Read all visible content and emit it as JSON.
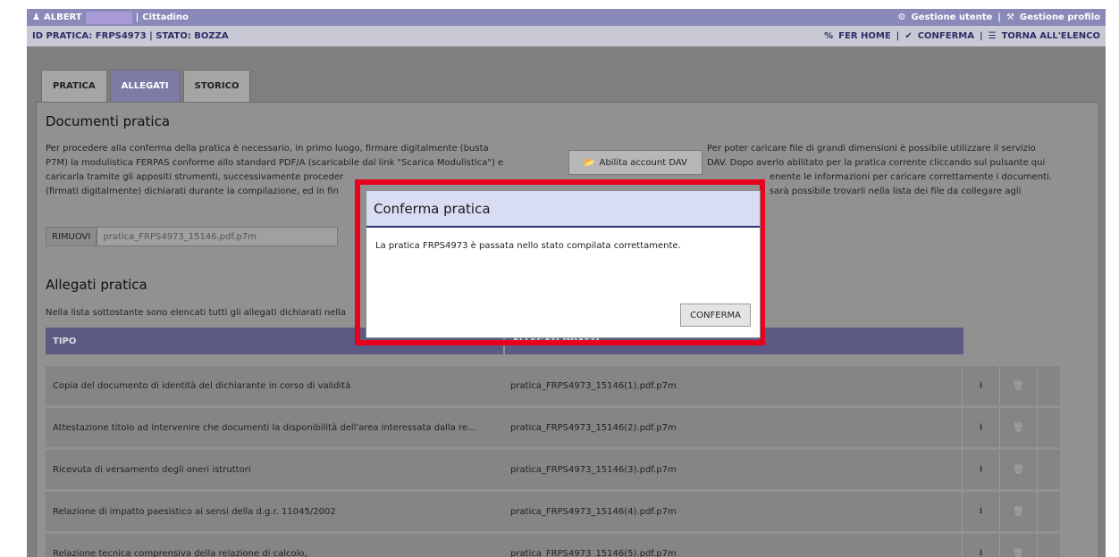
{
  "topbar": {
    "user": "ALBERT",
    "role": "Cittadino",
    "gestione_utente": "Gestione utente",
    "gestione_profilo": "Gestione profilo"
  },
  "subbar": {
    "id_stato": "ID PRATICA: FRPS4973 | STATO: BOZZA",
    "fer_home": "FER HOME",
    "conferma": "CONFERMA",
    "torna": "TORNA ALL'ELENCO"
  },
  "tabs": [
    "PRATICA",
    "ALLEGATI",
    "STORICO"
  ],
  "documenti": {
    "title": "Documenti pratica",
    "left_lines": [
      "Per procedere alla conferma della pratica è necessario, in primo luogo, firmare digitalmente (busta",
      "P7M) la modulistica FERPAS conforme allo standard PDF/A (scaricabile dal link \"Scarica Modulistica\") e",
      "caricarla tramite gli appositi strumenti, successivamente proceder",
      "(firmati digitalmente) dichiarati durante la compilazione, ed in fin"
    ],
    "dav_button": "Abilita account DAV",
    "right_lines": [
      "Per poter caricare file di grandi dimensioni è possibile utilizzare il servizio",
      "DAV. Dopo averlo abilitato per la pratica corrente cliccando sul pulsante qui",
      "enente le informazioni per caricare correttamente i documenti.",
      "sarà possibile trovarli nella lista dei file da collegare agli"
    ],
    "rimuovi": "RIMUOVI",
    "file": "pratica_FRPS4973_15146.pdf.p7m"
  },
  "allegati": {
    "title": "Allegati pratica",
    "intro": "Nella lista sottostante sono elencati tutti gli allegati dichiarati nella",
    "col_tipo": "TIPO",
    "col_allegato": "ALLEGATI DOATTI",
    "rows": [
      {
        "tipo": "Copia del documento di identità del dichiarante in corso di validità",
        "file": "pratica_FRPS4973_15146(1).pdf.p7m"
      },
      {
        "tipo": "Attestazione titolo ad intervenire che documenti la disponibilità dell'area interessata dalla re...",
        "file": "pratica_FRPS4973_15146(2).pdf.p7m"
      },
      {
        "tipo": "Ricevuta di versamento degli oneri istruttori",
        "file": "pratica_FRPS4973_15146(3).pdf.p7m"
      },
      {
        "tipo": "Relazione di impatto paesistico ai sensi della d.g.r. 11045/2002",
        "file": "pratica_FRPS4973_15146(4).pdf.p7m"
      },
      {
        "tipo": "Relazione tecnica comprensiva della relazione di calcolo,",
        "file": "pratica_FRPS4973_15146(5).pdf.p7m"
      }
    ]
  },
  "modal": {
    "title": "Conferma pratica",
    "message": "La pratica FRPS4973 è passata nello stato compilata correttamente.",
    "button": "CONFERMA"
  },
  "colors": {
    "topbar": "#8a8aba",
    "highlight": "#e8001c",
    "modal_header": "#d9ddf3"
  }
}
